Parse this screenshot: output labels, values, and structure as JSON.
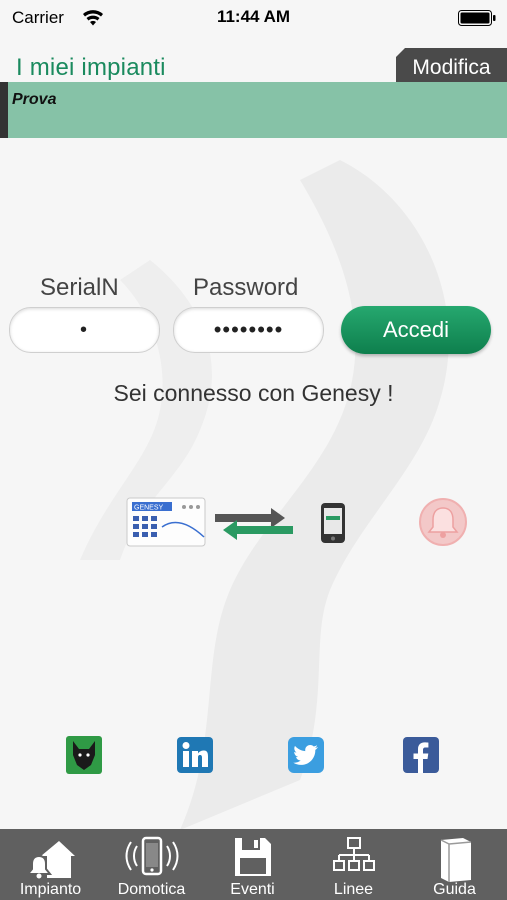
{
  "status_bar": {
    "carrier": "Carrier",
    "time": "11:44 AM"
  },
  "header": {
    "title": "I miei impianti",
    "edit_label": "Modifica",
    "site_name": "Prova"
  },
  "login": {
    "serial_label": "SerialN",
    "serial_value": "•",
    "password_label": "Password",
    "password_value": "••••••••",
    "submit_label": "Accedi",
    "status_message": "Sei connesso con Genesy !"
  },
  "diagram": {
    "panel_brand": "GENESY"
  },
  "icons": {
    "wifi": "wifi-icon",
    "battery": "battery-icon",
    "panel": "alarm-panel-icon",
    "arrows": "sync-arrows-icon",
    "phone": "phone-icon",
    "bell": "bell-icon",
    "wolf": "wolf-logo-icon",
    "linkedin": "linkedin-icon",
    "twitter": "twitter-icon",
    "facebook": "facebook-icon"
  },
  "colors": {
    "accent": "#1a8a5e",
    "site_bar": "#86c2a7",
    "button": "#0e7f4d",
    "tab_bar": "#606060",
    "bell": "#e45a5a"
  },
  "tabs": [
    {
      "label": "Impianto",
      "icon": "house-bell-icon"
    },
    {
      "label": "Domotica",
      "icon": "mobile-signal-icon"
    },
    {
      "label": "Eventi",
      "icon": "floppy-disk-icon"
    },
    {
      "label": "Linee",
      "icon": "network-icon"
    },
    {
      "label": "Guida",
      "icon": "book-icon"
    }
  ]
}
